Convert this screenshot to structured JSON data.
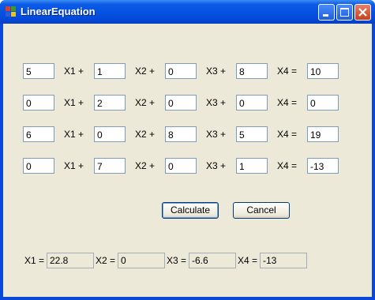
{
  "window": {
    "title": "LinearEquation"
  },
  "equations": [
    {
      "coefficients": [
        "5",
        "1",
        "0",
        "8"
      ],
      "result": "10"
    },
    {
      "coefficients": [
        "0",
        "2",
        "0",
        "0"
      ],
      "result": "0"
    },
    {
      "coefficients": [
        "6",
        "0",
        "8",
        "5"
      ],
      "result": "19"
    },
    {
      "coefficients": [
        "0",
        "7",
        "0",
        "1"
      ],
      "result": "-13"
    }
  ],
  "term_labels": [
    "X1 +",
    "X2 +",
    "X3 +",
    "X4 ="
  ],
  "buttons": {
    "calculate": "Calculate",
    "cancel": "Cancel"
  },
  "results": [
    {
      "label": "X1 =",
      "value": "22.8"
    },
    {
      "label": "X2 =",
      "value": "0"
    },
    {
      "label": "X3 =",
      "value": "-6.6"
    },
    {
      "label": "X4 =",
      "value": "-13"
    }
  ]
}
